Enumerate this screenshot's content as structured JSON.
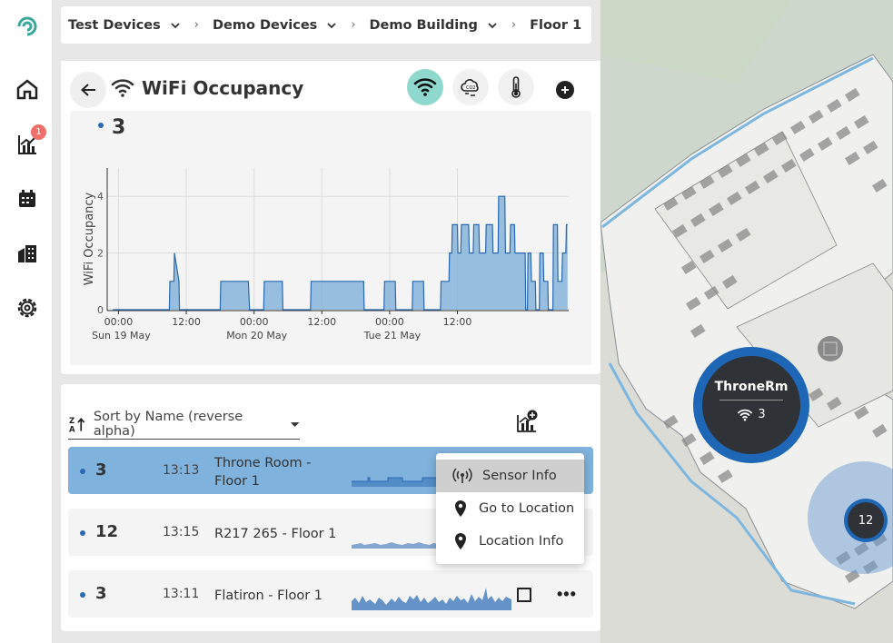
{
  "breadcrumb": [
    "Test Devices",
    "Demo Devices",
    "Demo Building",
    "Floor 1"
  ],
  "sidebar": {
    "reports_badge": "1"
  },
  "panel": {
    "title": "WiFi Occupancy",
    "current_value": "3"
  },
  "chart_data": {
    "type": "area",
    "ylabel": "WiFi Occupancy",
    "yticks": [
      "0",
      "2",
      "4"
    ],
    "ylim": [
      0,
      5
    ],
    "xticks": [
      {
        "time": "00:00",
        "date": "Sun 19 May"
      },
      {
        "time": "12:00",
        "date": ""
      },
      {
        "time": "00:00",
        "date": "Mon 20 May"
      },
      {
        "time": "12:00",
        "date": ""
      },
      {
        "time": "00:00",
        "date": "Tue 21 May"
      },
      {
        "time": "12:00",
        "date": ""
      }
    ],
    "x_hours": [
      -13,
      -3,
      -2.9,
      -2.2,
      -2.1,
      -1.3,
      -1.2,
      6,
      6.1,
      11,
      11.2,
      13.7,
      13.8,
      17,
      17.1,
      22,
      22.1,
      31.4,
      31.5,
      35,
      35.1,
      37,
      37.1,
      40,
      40.1,
      42,
      42.1,
      45,
      45.1,
      46.5,
      46.6,
      47,
      47.1,
      48,
      48.1,
      48.6,
      48.7,
      50,
      50.1,
      50.8,
      50.9,
      51.8,
      51.9,
      53,
      53.1,
      54.2,
      54.3,
      55.2,
      55.3,
      56.4,
      56.5,
      57.3,
      57.4,
      58.1,
      58.2,
      60,
      60.1,
      60.4,
      60.5,
      61,
      61.1,
      61.8,
      61.9,
      62.5,
      62.6,
      63.2,
      63.3,
      64,
      64.1,
      64.9,
      65.0,
      65.7,
      65.8,
      66.5,
      66.6,
      67.2,
      67.3,
      67.5
    ],
    "values": [
      0,
      0,
      1,
      1,
      2,
      1,
      0,
      0,
      1,
      1,
      0,
      0,
      1,
      1,
      0,
      0,
      1,
      1,
      0,
      0,
      1,
      1,
      0,
      0,
      1,
      1,
      0,
      0,
      1,
      1,
      2,
      2,
      3,
      3,
      2,
      2,
      3,
      3,
      2,
      2,
      3,
      3,
      2,
      2,
      3,
      3,
      2,
      2,
      4,
      4,
      2,
      2,
      3,
      3,
      2,
      2,
      0,
      0,
      2,
      2,
      1,
      1,
      0,
      0,
      2,
      2,
      1,
      1,
      0,
      0,
      3,
      3,
      1,
      1,
      2,
      2,
      3,
      3,
      2
    ]
  },
  "sort": {
    "label": "Sort by Name (reverse alpha)"
  },
  "rows": [
    {
      "value": "3",
      "time": "13:13",
      "name": "Throne Room - Floor 1"
    },
    {
      "value": "12",
      "time": "13:15",
      "name": "R217 265 - Floor 1"
    },
    {
      "value": "3",
      "time": "13:11",
      "name": "Flatiron - Floor 1"
    }
  ],
  "context_menu": [
    "Sensor Info",
    "Go to Location",
    "Location Info"
  ],
  "map": {
    "cluster_name": "ThroneRm",
    "cluster_value": "3",
    "cluster2_value": "12"
  },
  "colors": {
    "accent": "#1d67b6",
    "active_button": "#8fd8ce",
    "selected_row": "#7fb2dd",
    "badge": "#f0706a"
  }
}
